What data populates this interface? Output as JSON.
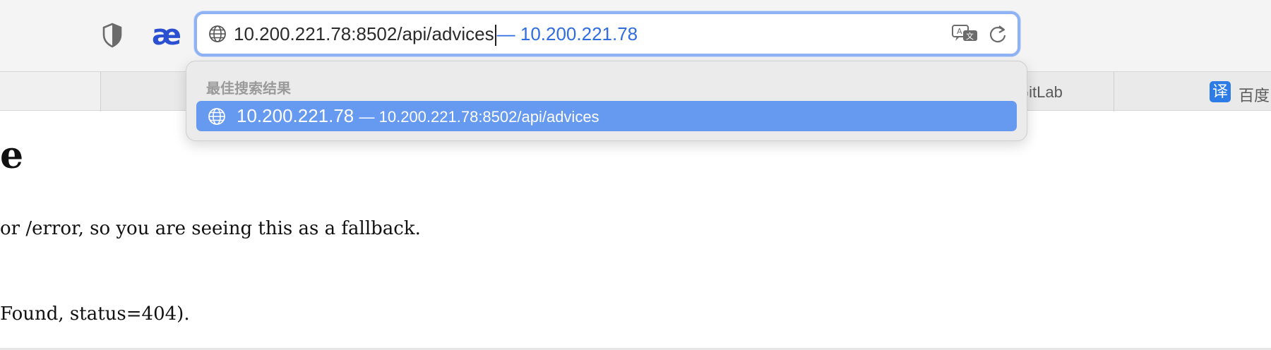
{
  "toolbar": {
    "icons": {
      "privacy": "shield-half-icon",
      "extension": "ae-icon"
    },
    "extension_glyph": "æ"
  },
  "urlbar": {
    "typed_text": "10.200.221.78:8502/api/advices",
    "autocomplete_hint": "— 10.200.221.78",
    "icons": {
      "leading": "globe-icon",
      "translate": "translate-icon",
      "reload": "reload-icon"
    }
  },
  "dropdown": {
    "section_header": "最佳搜索结果",
    "top_hit": {
      "title": "10.200.221.78",
      "subtitle": "— 10.200.221.78:8502/api/advices"
    }
  },
  "tabs": {
    "gitlab_label": "GitLab",
    "baidu_badge": "译",
    "baidu_label": "百度"
  },
  "page": {
    "heading": "e",
    "line1": "or /error, so you are seeing this as a fallback.",
    "line2": "Found, status=404)."
  },
  "colors": {
    "accent": "#2f6de0",
    "selection": "#6699f0",
    "focus_ring": "#8fb2f5",
    "extension": "#2a4fd1",
    "badge": "#2d7be5"
  }
}
